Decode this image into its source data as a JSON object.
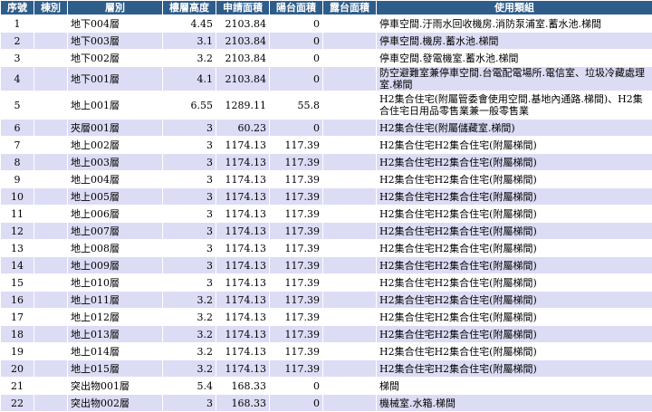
{
  "headers": [
    "序號",
    "棟別",
    "層別",
    "樓層高度",
    "申請面積",
    "陽台面積",
    "露台面積",
    "使用類組"
  ],
  "rows": [
    {
      "no": "1",
      "bldg": "",
      "floor": "地下004層",
      "height": "4.45",
      "area": "2103.84",
      "balcony": "0",
      "terrace": "",
      "use": "停車空間.汙雨水回收機房.消防泵浦室.蓄水池.梯間"
    },
    {
      "no": "2",
      "bldg": "",
      "floor": "地下003層",
      "height": "3.1",
      "area": "2103.84",
      "balcony": "0",
      "terrace": "",
      "use": "停車空間.機房.蓄水池.梯間"
    },
    {
      "no": "3",
      "bldg": "",
      "floor": "地下002層",
      "height": "3.2",
      "area": "2103.84",
      "balcony": "0",
      "terrace": "",
      "use": "停車空間.發電機室.蓄水池.梯間"
    },
    {
      "no": "4",
      "bldg": "",
      "floor": "地下001層",
      "height": "4.1",
      "area": "2103.84",
      "balcony": "0",
      "terrace": "",
      "use": "防空避難室兼停車空間.台電配電場所.電信室、垃圾冷藏處理室.梯間"
    },
    {
      "no": "5",
      "bldg": "",
      "floor": "地上001層",
      "height": "6.55",
      "area": "1289.11",
      "balcony": "55.8",
      "terrace": "",
      "use": "H2集合住宅(附屬管委會使用空間.基地內通路.梯間)、H2集合住宅日用品零售業兼一般零售業"
    },
    {
      "no": "6",
      "bldg": "",
      "floor": "夾層001層",
      "height": "3",
      "area": "60.23",
      "balcony": "0",
      "terrace": "",
      "use": "H2集合住宅(附屬儲藏室.梯間)"
    },
    {
      "no": "7",
      "bldg": "",
      "floor": "地上002層",
      "height": "3",
      "area": "1174.13",
      "balcony": "117.39",
      "terrace": "",
      "use": "H2集合住宅H2集合住宅(附屬梯間)"
    },
    {
      "no": "8",
      "bldg": "",
      "floor": "地上003層",
      "height": "3",
      "area": "1174.13",
      "balcony": "117.39",
      "terrace": "",
      "use": "H2集合住宅H2集合住宅(附屬梯間)"
    },
    {
      "no": "9",
      "bldg": "",
      "floor": "地上004層",
      "height": "3",
      "area": "1174.13",
      "balcony": "117.39",
      "terrace": "",
      "use": "H2集合住宅H2集合住宅(附屬梯間)"
    },
    {
      "no": "10",
      "bldg": "",
      "floor": "地上005層",
      "height": "3",
      "area": "1174.13",
      "balcony": "117.39",
      "terrace": "",
      "use": "H2集合住宅H2集合住宅(附屬梯間)"
    },
    {
      "no": "11",
      "bldg": "",
      "floor": "地上006層",
      "height": "3",
      "area": "1174.13",
      "balcony": "117.39",
      "terrace": "",
      "use": "H2集合住宅H2集合住宅(附屬梯間)"
    },
    {
      "no": "12",
      "bldg": "",
      "floor": "地上007層",
      "height": "3",
      "area": "1174.13",
      "balcony": "117.39",
      "terrace": "",
      "use": "H2集合住宅H2集合住宅(附屬梯間)"
    },
    {
      "no": "13",
      "bldg": "",
      "floor": "地上008層",
      "height": "3",
      "area": "1174.13",
      "balcony": "117.39",
      "terrace": "",
      "use": "H2集合住宅H2集合住宅(附屬梯間)"
    },
    {
      "no": "14",
      "bldg": "",
      "floor": "地上009層",
      "height": "3",
      "area": "1174.13",
      "balcony": "117.39",
      "terrace": "",
      "use": "H2集合住宅H2集合住宅(附屬梯間)"
    },
    {
      "no": "15",
      "bldg": "",
      "floor": "地上010層",
      "height": "3",
      "area": "1174.13",
      "balcony": "117.39",
      "terrace": "",
      "use": "H2集合住宅H2集合住宅(附屬梯間)"
    },
    {
      "no": "16",
      "bldg": "",
      "floor": "地上011層",
      "height": "3.2",
      "area": "1174.13",
      "balcony": "117.39",
      "terrace": "",
      "use": "H2集合住宅H2集合住宅(附屬梯間)"
    },
    {
      "no": "17",
      "bldg": "",
      "floor": "地上012層",
      "height": "3.2",
      "area": "1174.13",
      "balcony": "117.39",
      "terrace": "",
      "use": "H2集合住宅H2集合住宅(附屬梯間)"
    },
    {
      "no": "18",
      "bldg": "",
      "floor": "地上013層",
      "height": "3.2",
      "area": "1174.13",
      "balcony": "117.39",
      "terrace": "",
      "use": "H2集合住宅H2集合住宅(附屬梯間)"
    },
    {
      "no": "19",
      "bldg": "",
      "floor": "地上014層",
      "height": "3.2",
      "area": "1174.13",
      "balcony": "117.39",
      "terrace": "",
      "use": "H2集合住宅H2集合住宅(附屬梯間)"
    },
    {
      "no": "20",
      "bldg": "",
      "floor": "地上015層",
      "height": "3.2",
      "area": "1174.13",
      "balcony": "117.39",
      "terrace": "",
      "use": "H2集合住宅H2集合住宅(附屬梯間)"
    },
    {
      "no": "21",
      "bldg": "",
      "floor": "突出物001層",
      "height": "5.4",
      "area": "168.33",
      "balcony": "0",
      "terrace": "",
      "use": "梯間"
    },
    {
      "no": "22",
      "bldg": "",
      "floor": "突出物002層",
      "height": "3",
      "area": "168.33",
      "balcony": "0",
      "terrace": "",
      "use": "機械室.水箱.梯間"
    }
  ]
}
